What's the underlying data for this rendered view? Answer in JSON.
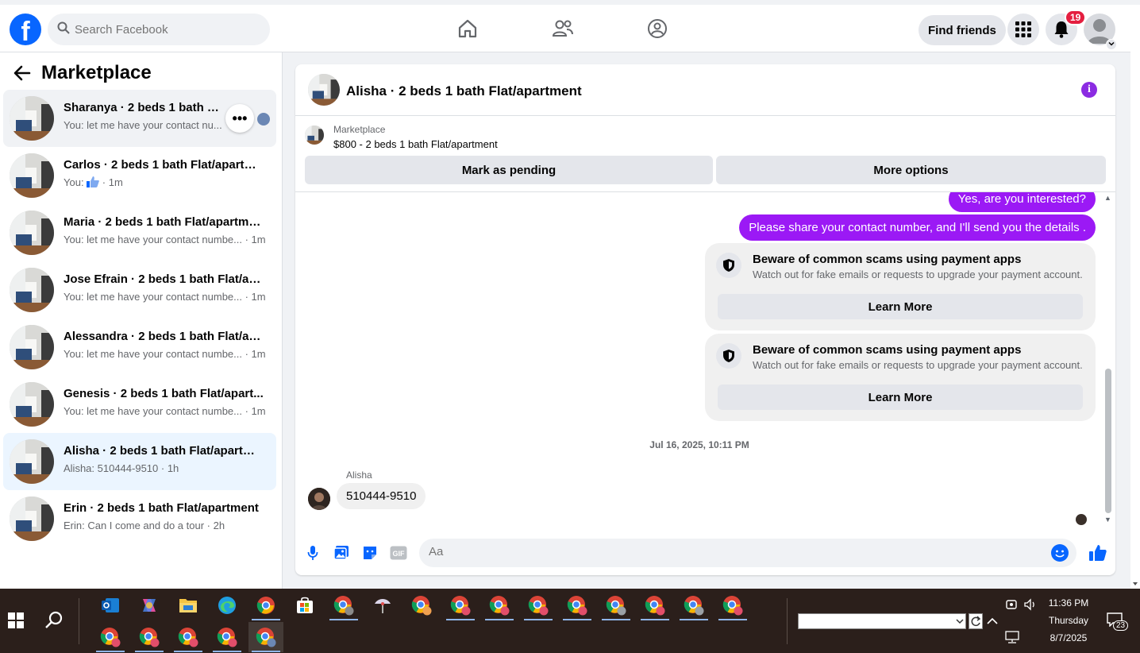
{
  "topnav": {
    "logo": "f",
    "search_placeholder": "Search Facebook",
    "find_friends": "Find friends",
    "notification_count": "19"
  },
  "sidebar": {
    "title": "Marketplace",
    "conversations": [
      {
        "title": "Sharanya · 2 beds 1 bath Flat/apartment",
        "sub": "You: let me have your contact nu..."
      },
      {
        "title": "Carlos · 2 beds 1 bath Flat/apartm...",
        "sub_prefix": "You: ",
        "sub_suffix": " · 1m"
      },
      {
        "title": "Maria · 2 beds 1 bath Flat/apartment",
        "sub": "You: let me have your contact numbe... · 1m"
      },
      {
        "title": "Jose Efrain · 2 beds 1 bath Flat/apa...",
        "sub": "You: let me have your contact numbe... · 1m"
      },
      {
        "title": "Alessandra · 2 beds 1 bath Flat/apa...",
        "sub": "You: let me have your contact numbe... · 1m"
      },
      {
        "title": "Genesis · 2 beds 1 bath Flat/apart...",
        "sub": "You: let me have your contact numbe... · 1m"
      },
      {
        "title": "Alisha · 2 beds 1 bath Flat/apartme...",
        "sub": "Alisha: 510444-9510 · 1h"
      },
      {
        "title": "Erin · 2 beds 1 bath Flat/apartment",
        "sub": "Erin: Can I come and do a tour · 2h"
      }
    ],
    "more_label": "•••"
  },
  "chat": {
    "header_name": "Alisha · 2 beds 1 bath Flat/apartment",
    "info_label": "i",
    "listing_source": "Marketplace",
    "listing_price": "$800 - 2 beds 1 bath Flat/apartment",
    "mark_pending": "Mark as pending",
    "more_options": "More options",
    "messages": {
      "out1": "Yes, are you interested?",
      "out2": "Please share your contact number, and I'll send you the details .",
      "warning_title": "Beware of common scams using payment apps",
      "warning_desc": "Watch out for fake emails or requests to upgrade your payment account.",
      "learn_more": "Learn More",
      "timestamp": "Jul 16, 2025, 10:11 PM",
      "sender": "Alisha",
      "in1": "510444-9510"
    },
    "composer_placeholder": "Aa"
  },
  "taskbar": {
    "time": "11:36 PM",
    "day": "Thursday",
    "date": "8/7/2025",
    "notif_count": "23"
  },
  "colors": {
    "fb_blue": "#0866ff",
    "messenger_purple": "#9b19f5",
    "badge_red": "#e41e3f"
  }
}
